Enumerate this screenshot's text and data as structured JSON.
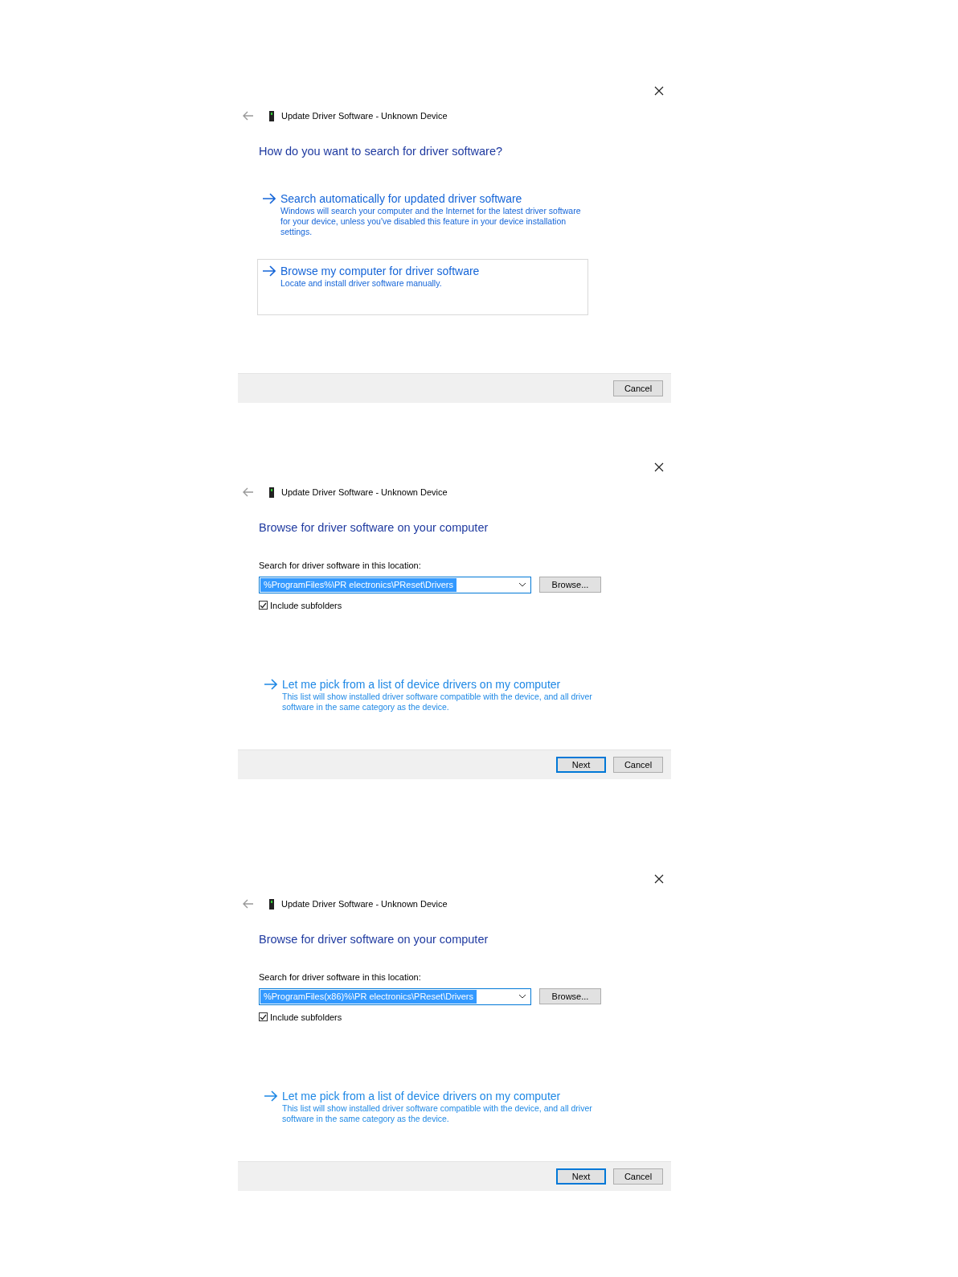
{
  "dialogs": [
    {
      "kind": "choice",
      "title": "Update Driver Software - Unknown Device",
      "heading": "How do you want to search for driver software?",
      "options": [
        {
          "title": "Search automatically for updated driver software",
          "description": "Windows will search your computer and the Internet for the latest driver software for your device, unless you've disabled this feature in your device installation settings.",
          "selected": false
        },
        {
          "title": "Browse my computer for driver software",
          "description": "Locate and install driver software manually.",
          "selected": true
        }
      ],
      "buttons": [
        {
          "label": "Cancel",
          "default": false
        }
      ]
    },
    {
      "kind": "browse",
      "title": "Update Driver Software - Unknown Device",
      "heading": "Browse for driver software on your computer",
      "location_label": "Search for driver software in this location:",
      "location": {
        "value": "%ProgramFiles%\\PR electronics\\PReset\\Drivers"
      },
      "browse_button": "Browse...",
      "include_subfolders": {
        "label": "Include subfolders",
        "checked": true
      },
      "link": {
        "title": "Let me pick from a list of device drivers on my computer",
        "description": "This list will show installed driver software compatible with the device, and all driver software in the same category as the device."
      },
      "buttons": [
        {
          "label": "Next",
          "default": true
        },
        {
          "label": "Cancel",
          "default": false
        }
      ]
    },
    {
      "kind": "browse",
      "title": "Update Driver Software - Unknown Device",
      "heading": "Browse for driver software on your computer",
      "location_label": "Search for driver software in this location:",
      "location": {
        "value": "%ProgramFiles(x86)%\\PR electronics\\PReset\\Drivers"
      },
      "browse_button": "Browse...",
      "include_subfolders": {
        "label": "Include subfolders",
        "checked": true
      },
      "link": {
        "title": "Let me pick from a list of device drivers on my computer",
        "description": "This list will show installed driver software compatible with the device, and all driver software in the same category as the device."
      },
      "buttons": [
        {
          "label": "Next",
          "default": true
        },
        {
          "label": "Cancel",
          "default": false
        }
      ]
    }
  ]
}
